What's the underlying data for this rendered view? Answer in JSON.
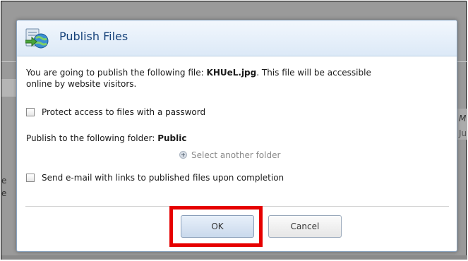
{
  "dialog": {
    "title": "Publish Files",
    "intro_prefix": "You are going to publish the following file:",
    "file_name": "KHUeL.jpg",
    "intro_suffix": ". This file will be accessible",
    "intro_line2": "online by website visitors.",
    "protect_label": "Protect access to files with a password",
    "folder_prefix": "Publish to the following folder:",
    "folder_name": "Public",
    "select_folder_link": "Select another folder",
    "email_label": "Send e-mail with links to published files upon completion",
    "ok_label": "OK",
    "cancel_label": "Cancel"
  },
  "background": {
    "frag_right_top": "M",
    "frag_right_bottom": "Ju",
    "frag_left_1": "e",
    "frag_left_2": "e"
  },
  "colors": {
    "highlight": "#e60000",
    "title_text": "#16427a"
  }
}
